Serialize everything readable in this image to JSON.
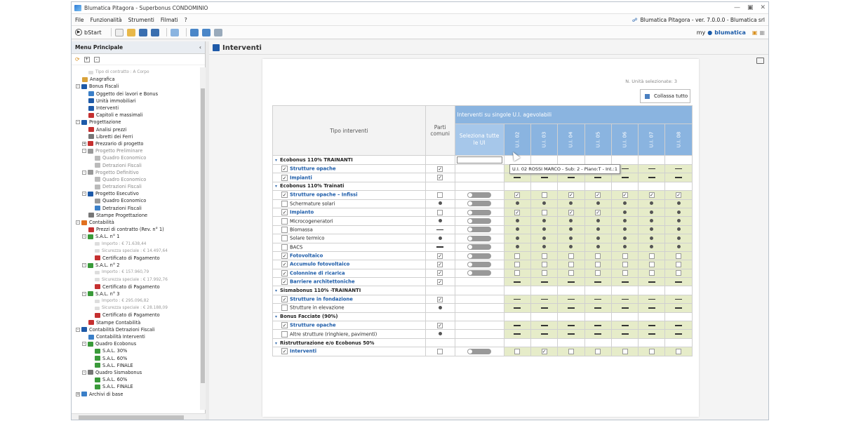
{
  "window": {
    "title": "Blumatica Pitagora - Superbonus CONDOMINIO"
  },
  "menubar": {
    "items": [
      "File",
      "Funzionalità",
      "Strumenti",
      "Filmati",
      "?"
    ],
    "version": "Blumatica Pitagora - ver. 7.0.0.0 - Blumatica srl"
  },
  "toolbar": {
    "bstart": "bStart",
    "brand_my": "my",
    "brand_name": "blumatica"
  },
  "sidebar": {
    "title": "Menu Principale",
    "tree": [
      {
        "label": "Tipo di contratto : A Corpo",
        "lvl": 2,
        "g": true
      },
      {
        "label": "Anagrafica",
        "lvl": 1,
        "ic": "#d9a23a"
      },
      {
        "label": "Bonus Fiscali",
        "lvl": 0,
        "ex": "-",
        "ic": "#1e5aa8"
      },
      {
        "label": "Oggetto dei lavori e Bonus",
        "lvl": 2,
        "ic": "#3a7fc8"
      },
      {
        "label": "Unità immobiliari",
        "lvl": 2,
        "ic": "#1e5aa8"
      },
      {
        "label": "Interventi",
        "lvl": 2,
        "ic": "#1e5aa8"
      },
      {
        "label": "Capitoli e massimali",
        "lvl": 2,
        "ic": "#c53030"
      },
      {
        "label": "Progettazione",
        "lvl": 0,
        "ex": "-",
        "ic": "#1e5aa8"
      },
      {
        "label": "Analisi prezzi",
        "lvl": 2,
        "ic": "#c53030"
      },
      {
        "label": "Libretti dei Ferri",
        "lvl": 2,
        "ic": "#777"
      },
      {
        "label": "Prezzario di progetto",
        "lvl": 1,
        "ex": "+",
        "ic": "#c53030"
      },
      {
        "label": "Progetto Preliminare",
        "lvl": 1,
        "ex": "-",
        "ic": "#999",
        "g2": true
      },
      {
        "label": "Quadro Economico",
        "lvl": 3,
        "ic": "#bbb",
        "g2": true
      },
      {
        "label": "Detrazioni Fiscali",
        "lvl": 3,
        "ic": "#bbb",
        "g2": true
      },
      {
        "label": "Progetto Definitivo",
        "lvl": 1,
        "ex": "-",
        "ic": "#999",
        "g2": true
      },
      {
        "label": "Quadro Economico",
        "lvl": 3,
        "ic": "#bbb",
        "g2": true
      },
      {
        "label": "Detrazioni Fiscali",
        "lvl": 3,
        "ic": "#bbb",
        "g2": true
      },
      {
        "label": "Progetto Esecutivo",
        "lvl": 1,
        "ex": "-",
        "ic": "#1e5aa8"
      },
      {
        "label": "Quadro Economico",
        "lvl": 3,
        "ic": "#999"
      },
      {
        "label": "Detrazioni Fiscali",
        "lvl": 3,
        "ic": "#3a7fc8"
      },
      {
        "label": "Stampe Progettazione",
        "lvl": 2,
        "ic": "#777"
      },
      {
        "label": "Contabilità",
        "lvl": 0,
        "ex": "-",
        "ic": "#e07020"
      },
      {
        "label": "Prezzi di contratto (Rev. n° 1)",
        "lvl": 2,
        "ic": "#c53030"
      },
      {
        "label": "S.A.L. n° 1",
        "lvl": 1,
        "ex": "-",
        "ic": "#3a9a3a"
      },
      {
        "label": "Importo : € 71.638,44",
        "lvl": 3,
        "g": true
      },
      {
        "label": "Sicurezza speciale : € 14.497,64",
        "lvl": 3,
        "g": true
      },
      {
        "label": "Certificato di Pagamento",
        "lvl": 3,
        "ic": "#c53030"
      },
      {
        "label": "S.A.L. n° 2",
        "lvl": 1,
        "ex": "-",
        "ic": "#3a9a3a"
      },
      {
        "label": "Importo : € 157.960,79",
        "lvl": 3,
        "g": true
      },
      {
        "label": "Sicurezza speciale : € 17.992,76",
        "lvl": 3,
        "g": true
      },
      {
        "label": "Certificato di Pagamento",
        "lvl": 3,
        "ic": "#c53030"
      },
      {
        "label": "S.A.L. n° 3",
        "lvl": 1,
        "ex": "-",
        "ic": "#3a9a3a"
      },
      {
        "label": "Importo : € 295.096,82",
        "lvl": 3,
        "g": true
      },
      {
        "label": "Sicurezza speciale : € 28.188,09",
        "lvl": 3,
        "g": true
      },
      {
        "label": "Certificato di Pagamento",
        "lvl": 3,
        "ic": "#c53030"
      },
      {
        "label": "Stampe Contabilità",
        "lvl": 2,
        "ic": "#c53030"
      },
      {
        "label": "Contabilità Detrazioni Fiscali",
        "lvl": 0,
        "ex": "-",
        "ic": "#1e5aa8"
      },
      {
        "label": "Contabilità Interventi",
        "lvl": 2,
        "ic": "#3a7fc8"
      },
      {
        "label": "Quadro Ecobonus",
        "lvl": 1,
        "ex": "-",
        "ic": "#3a9a3a"
      },
      {
        "label": "S.A.L. 30%",
        "lvl": 3,
        "ic": "#3a9a3a"
      },
      {
        "label": "S.A.L. 60%",
        "lvl": 3,
        "ic": "#3a9a3a"
      },
      {
        "label": "S.A.L. FINALE",
        "lvl": 3,
        "ic": "#3a9a3a"
      },
      {
        "label": "Quadro Sismabonus",
        "lvl": 1,
        "ex": "-",
        "ic": "#777"
      },
      {
        "label": "S.A.L. 60%",
        "lvl": 3,
        "ic": "#3a9a3a"
      },
      {
        "label": "S.A.L. FINALE",
        "lvl": 3,
        "ic": "#3a9a3a"
      },
      {
        "label": "Archivi di base",
        "lvl": 0,
        "ex": "+",
        "ic": "#3a7fc8"
      }
    ]
  },
  "main": {
    "title": "Interventi",
    "n_selected": "N. Unità selezionate: 3",
    "collapse_label": "Collassa tutto",
    "tooltip": "U.I. 02 ROSSI MARCO - Sub: 2 - Piano:T - Int.:1",
    "headers": {
      "tipo": "Tipo interventi",
      "parti": "Parti comuni",
      "group": "Interventi su singole U.I. agevolabili",
      "select_all": "Seleziona tutte le UI",
      "units": [
        "U.I. 02",
        "U.I. 03",
        "U.I. 04",
        "U.I. 05",
        "U.I. 06",
        "U.I. 07",
        "U.I. 08"
      ]
    },
    "rows": [
      {
        "t": "group",
        "name": "Ecobonus 110% TRAINANTI",
        "sel": "input"
      },
      {
        "t": "item",
        "name": "Strutture opache",
        "checked": true,
        "link": true,
        "parti": "check",
        "units": [
          "-",
          "-",
          "-",
          "-",
          "-",
          "-",
          "-"
        ]
      },
      {
        "t": "item",
        "name": "Impianti",
        "checked": true,
        "link": true,
        "parti": "check",
        "units": [
          "-",
          "-",
          "-",
          "-",
          "-",
          "-",
          "-"
        ]
      },
      {
        "t": "group",
        "name": "Ecobonus 110% Trainati"
      },
      {
        "t": "item",
        "name": "Strutture opache – Infissi",
        "checked": true,
        "link": true,
        "parti": "box",
        "sel": "toggle",
        "units": [
          "check",
          "box",
          "check",
          "check",
          "check",
          "check",
          "check"
        ]
      },
      {
        "t": "item",
        "name": "Schermature solari",
        "parti": "dot",
        "sel": "toggle",
        "units": [
          "dot",
          "dot",
          "dot",
          "dot",
          "dot",
          "dot",
          "dot"
        ]
      },
      {
        "t": "item",
        "name": "Impianto",
        "checked": true,
        "link": true,
        "parti": "box",
        "sel": "toggle",
        "units": [
          "check",
          "box",
          "check",
          "check",
          "dot",
          "dot",
          "dot"
        ]
      },
      {
        "t": "item",
        "name": "Microcogeneratori",
        "parti": "dot",
        "sel": "toggle",
        "units": [
          "dot",
          "dot",
          "dot",
          "dot",
          "dot",
          "dot",
          "dot"
        ]
      },
      {
        "t": "item",
        "name": "Biomassa",
        "parti": "-",
        "sel": "toggle",
        "units": [
          "dot",
          "dot",
          "dot",
          "dot",
          "dot",
          "dot",
          "dot"
        ]
      },
      {
        "t": "item",
        "name": "Solare termico",
        "parti": "dot",
        "sel": "toggle",
        "units": [
          "dot",
          "dot",
          "dot",
          "dot",
          "dot",
          "dot",
          "dot"
        ]
      },
      {
        "t": "item",
        "name": "BACS",
        "parti": "-",
        "sel": "toggle",
        "units": [
          "dot",
          "dot",
          "dot",
          "dot",
          "dot",
          "dot",
          "dot"
        ]
      },
      {
        "t": "item",
        "name": "Fotovoltaico",
        "checked": true,
        "link": true,
        "parti": "check",
        "sel": "toggle",
        "units": [
          "box",
          "box",
          "box",
          "box",
          "box",
          "box",
          "box"
        ]
      },
      {
        "t": "item",
        "name": "Accumulo fotovoltaico",
        "checked": true,
        "link": true,
        "parti": "check",
        "sel": "toggle",
        "units": [
          "box",
          "box",
          "box",
          "box",
          "box",
          "box",
          "box"
        ]
      },
      {
        "t": "item",
        "name": "Colonnine di ricarica",
        "checked": true,
        "link": true,
        "parti": "check",
        "sel": "toggle",
        "units": [
          "box",
          "box",
          "box",
          "box",
          "box",
          "box",
          "box"
        ]
      },
      {
        "t": "item",
        "name": "Barriere architettoniche",
        "checked": true,
        "link": true,
        "parti": "check",
        "units": [
          "-",
          "-",
          "-",
          "-",
          "-",
          "-",
          "-"
        ]
      },
      {
        "t": "group",
        "name": "Sismabonus 110% -TRAINANTI"
      },
      {
        "t": "item",
        "name": "Strutture in fondazione",
        "checked": true,
        "link": true,
        "parti": "check",
        "units": [
          "-",
          "-",
          "-",
          "-",
          "-",
          "-",
          "-"
        ]
      },
      {
        "t": "item",
        "name": "Strutture in elevazione",
        "parti": "dot",
        "units": [
          "-",
          "-",
          "-",
          "-",
          "-",
          "-",
          "-"
        ]
      },
      {
        "t": "group",
        "name": "Bonus Facciate (90%)"
      },
      {
        "t": "item",
        "name": "Strutture opache",
        "checked": true,
        "link": true,
        "parti": "check",
        "units": [
          "-",
          "-",
          "-",
          "-",
          "-",
          "-",
          "-"
        ]
      },
      {
        "t": "item",
        "name": "Altre strutture (ringhiere, pavimenti)",
        "parti": "dot",
        "units": [
          "-",
          "-",
          "-",
          "-",
          "-",
          "-",
          "-"
        ]
      },
      {
        "t": "group",
        "name": "Ristrutturazione e/o Ecobonus 50%"
      },
      {
        "t": "item",
        "name": "Interventi",
        "checked": true,
        "link": true,
        "parti": "box",
        "sel": "toggle",
        "units": [
          "box",
          "check",
          "box",
          "box",
          "box",
          "box",
          "box"
        ]
      }
    ]
  }
}
